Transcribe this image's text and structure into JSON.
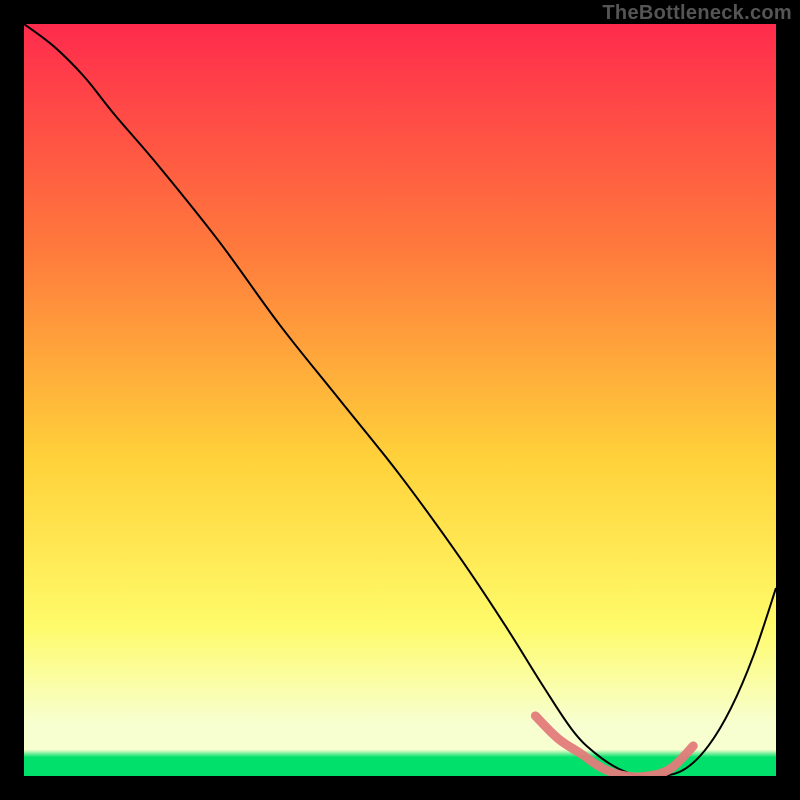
{
  "watermark": "TheBottleneck.com",
  "chart_data": {
    "type": "line",
    "title": "",
    "xlabel": "",
    "ylabel": "",
    "xlim": [
      0,
      100
    ],
    "ylim": [
      0,
      100
    ],
    "grid": false,
    "legend": false,
    "background_gradient": {
      "top": "#ff2b4d",
      "mid1": "#ff7a3c",
      "mid2": "#ffd23a",
      "mid3": "#fffb6a",
      "bottom_band": "#f7ffd0",
      "bottom": "#00e06a"
    },
    "series": [
      {
        "name": "curve",
        "stroke": "#000000",
        "stroke_width": 2,
        "x": [
          0,
          4,
          8,
          12,
          18,
          26,
          34,
          42,
          50,
          58,
          64,
          69,
          73,
          76,
          79,
          82,
          85,
          88,
          91,
          94,
          97,
          100
        ],
        "y": [
          100,
          97,
          93,
          88,
          81,
          71,
          60,
          50,
          40,
          29,
          20,
          12,
          6,
          3,
          1,
          0,
          0,
          1,
          4,
          9,
          16,
          25
        ]
      },
      {
        "name": "highlight-band",
        "stroke": "#e37b7b",
        "stroke_width": 9,
        "linecap": "round",
        "x": [
          68,
          71,
          74,
          77,
          80,
          83,
          86,
          89
        ],
        "y": [
          8,
          5,
          3,
          1,
          0,
          0,
          1,
          4
        ]
      }
    ]
  }
}
